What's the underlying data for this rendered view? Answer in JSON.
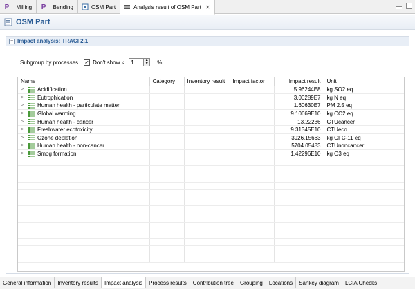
{
  "tabs": [
    {
      "label": "_Milling",
      "icon": "P"
    },
    {
      "label": "_Bending",
      "icon": "P"
    },
    {
      "label": "OSM Part",
      "icon": "model-icon"
    },
    {
      "label": "Analysis result of OSM Part",
      "icon": "results-icon",
      "active": true
    }
  ],
  "header": {
    "title": "OSM Part"
  },
  "section": {
    "title": "Impact analysis: TRACI 2.1"
  },
  "controls": {
    "subgroup_label": "Subgroup by processes",
    "dont_show_label": "Don't show <",
    "threshold_value": "1",
    "percent": "%"
  },
  "table": {
    "headers": [
      "Name",
      "Category",
      "Inventory result",
      "Impact factor",
      "Impact result",
      "Unit"
    ],
    "rows": [
      {
        "name": "Acidification",
        "impact_result": "5.96244E8",
        "unit": "kg SO2 eq"
      },
      {
        "name": "Eutrophication",
        "impact_result": "3.00289E7",
        "unit": "kg N eq"
      },
      {
        "name": "Human health - particulate matter",
        "impact_result": "1.60630E7",
        "unit": "PM 2.5 eq"
      },
      {
        "name": "Global warming",
        "impact_result": "9.10669E10",
        "unit": "kg CO2 eq"
      },
      {
        "name": "Human health - cancer",
        "impact_result": "13.22236",
        "unit": "CTUcancer"
      },
      {
        "name": "Freshwater ecotoxicity",
        "impact_result": "9.31345E10",
        "unit": "CTUeco"
      },
      {
        "name": "Ozone depletion",
        "impact_result": "3926.15663",
        "unit": "kg CFC-11 eq"
      },
      {
        "name": "Human health - non-cancer",
        "impact_result": "5704.05483",
        "unit": "CTUnoncancer"
      },
      {
        "name": "Smog formation",
        "impact_result": "1.42296E10",
        "unit": "kg O3 eq"
      }
    ]
  },
  "bottom_tabs": [
    "General information",
    "Inventory results",
    "Impact analysis",
    "Process results",
    "Contribution tree",
    "Grouping",
    "Locations",
    "Sankey diagram",
    "LCIA Checks"
  ]
}
